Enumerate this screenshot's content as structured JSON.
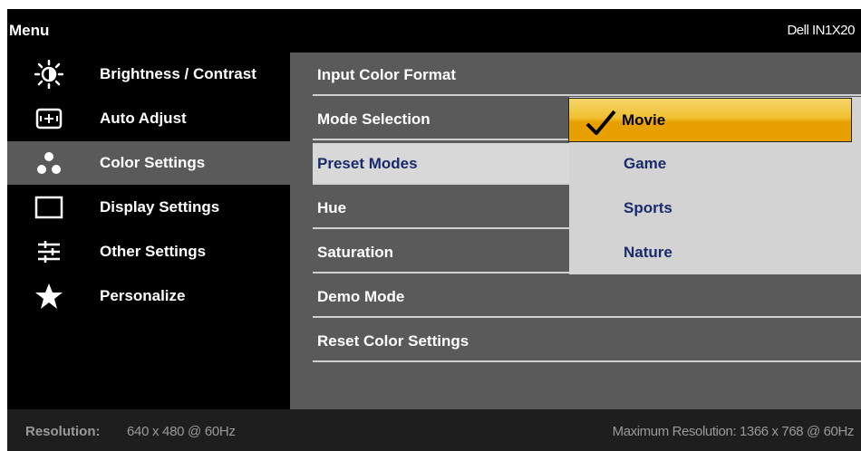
{
  "header": {
    "menu_title": "Menu",
    "model": "Dell IN1X20"
  },
  "sidebar": {
    "items": [
      {
        "label": "Brightness / Contrast",
        "icon": "brightness-icon",
        "active": false
      },
      {
        "label": "Auto Adjust",
        "icon": "auto-adjust-icon",
        "active": false
      },
      {
        "label": "Color Settings",
        "icon": "color-settings-icon",
        "active": true
      },
      {
        "label": "Display Settings",
        "icon": "display-icon",
        "active": false
      },
      {
        "label": "Other Settings",
        "icon": "sliders-icon",
        "active": false
      },
      {
        "label": "Personalize",
        "icon": "star-icon",
        "active": false
      }
    ]
  },
  "panel": {
    "options": [
      {
        "label": "Input Color Format",
        "selected": false
      },
      {
        "label": "Mode Selection",
        "selected": false
      },
      {
        "label": "Preset Modes",
        "selected": true
      },
      {
        "label": "Hue",
        "selected": false
      },
      {
        "label": "Saturation",
        "selected": false
      },
      {
        "label": "Demo Mode",
        "selected": false
      },
      {
        "label": "Reset Color Settings",
        "selected": false
      }
    ]
  },
  "submenu": {
    "items": [
      {
        "label": "Movie",
        "checked": true
      },
      {
        "label": "Game",
        "checked": false
      },
      {
        "label": "Sports",
        "checked": false
      },
      {
        "label": "Nature",
        "checked": false
      }
    ]
  },
  "footer": {
    "resolution_label": "Resolution:",
    "resolution_value": "640 x 480 @ 60Hz",
    "max_resolution": "Maximum Resolution: 1366 x 768 @ 60Hz"
  },
  "colors": {
    "background": "#000000",
    "panel": "#5a5a5a",
    "submenu": "#d3d3d3",
    "highlight": "#f0c030",
    "selected_text": "#1a2b6b"
  }
}
